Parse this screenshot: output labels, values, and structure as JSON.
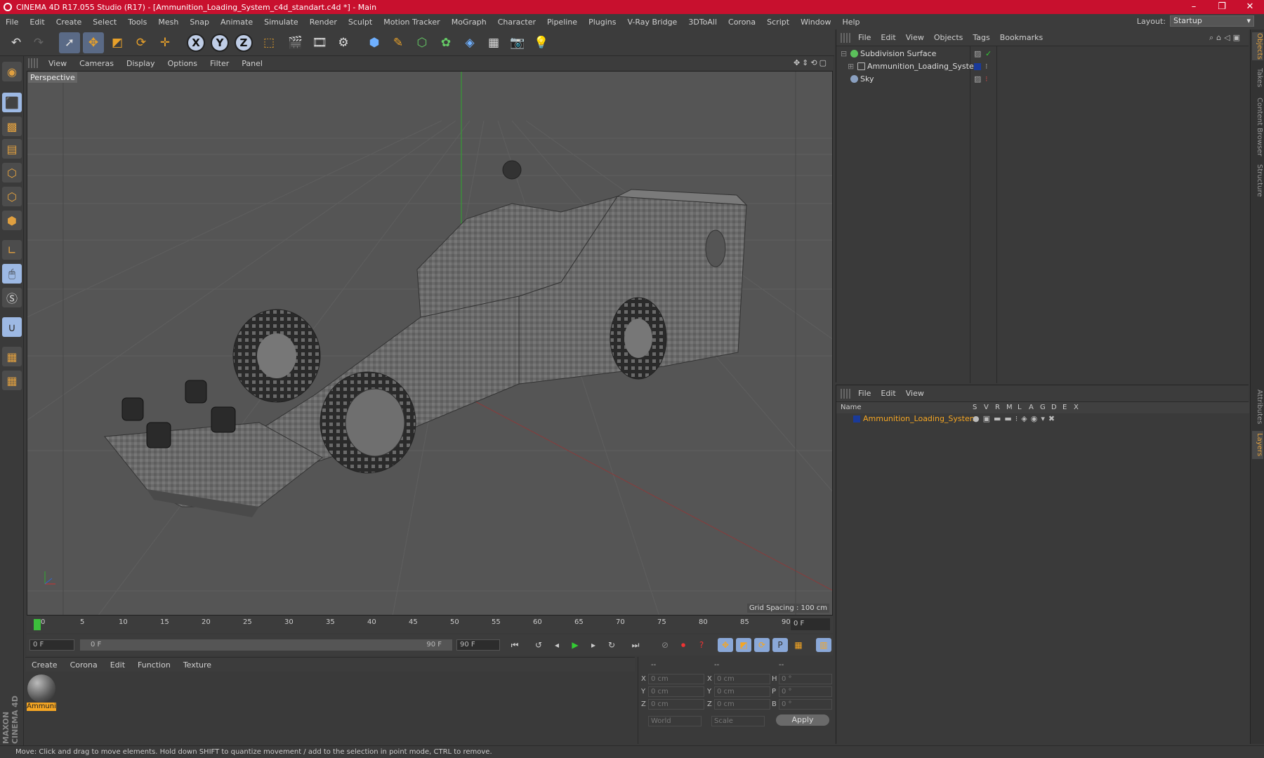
{
  "window": {
    "title": "CINEMA 4D R17.055 Studio (R17) - [Ammunition_Loading_System_c4d_standart.c4d *] - Main",
    "controls": [
      "–",
      "❐",
      "✕"
    ]
  },
  "menubar": {
    "items": [
      "File",
      "Edit",
      "Create",
      "Select",
      "Tools",
      "Mesh",
      "Snap",
      "Animate",
      "Simulate",
      "Render",
      "Sculpt",
      "Motion Tracker",
      "MoGraph",
      "Character",
      "Pipeline",
      "Plugins",
      "V-Ray Bridge",
      "3DToAll",
      "Corona",
      "Script",
      "Window",
      "Help"
    ],
    "layout_label": "Layout:",
    "layout_value": "Startup"
  },
  "viewport": {
    "menu": [
      "View",
      "Cameras",
      "Display",
      "Options",
      "Filter",
      "Panel"
    ],
    "label": "Perspective",
    "grid_spacing": "Grid Spacing : 100 cm"
  },
  "timeline": {
    "ticks": [
      "0",
      "5",
      "10",
      "15",
      "20",
      "25",
      "30",
      "35",
      "40",
      "45",
      "50",
      "55",
      "60",
      "65",
      "70",
      "75",
      "80",
      "85",
      "90"
    ],
    "current_frame": "0 F",
    "start_field": "0 F",
    "range_start": "0 F",
    "range_end": "90 F",
    "end_field": "90 F"
  },
  "material_panel": {
    "menu": [
      "Create",
      "Corona",
      "Edit",
      "Function",
      "Texture"
    ],
    "material_name": "Ammuni"
  },
  "coordinates": {
    "headers": [
      "--",
      "--",
      "--"
    ],
    "rows": [
      {
        "a": "X",
        "av": "0 cm",
        "b": "X",
        "bv": "0 cm",
        "c": "H",
        "cv": "0 °"
      },
      {
        "a": "Y",
        "av": "0 cm",
        "b": "Y",
        "bv": "0 cm",
        "c": "P",
        "cv": "0 °"
      },
      {
        "a": "Z",
        "av": "0 cm",
        "b": "Z",
        "bv": "0 cm",
        "c": "B",
        "cv": "0 °"
      }
    ],
    "mode": "World",
    "scale": "Scale",
    "apply": "Apply"
  },
  "object_manager": {
    "menu": [
      "File",
      "Edit",
      "View",
      "Objects",
      "Tags",
      "Bookmarks"
    ],
    "objects": [
      {
        "name": "Subdivision Surface",
        "color": "#5bc05b"
      },
      {
        "name": "Ammunition_Loading_System",
        "color": "#9ab"
      },
      {
        "name": "Sky",
        "color": "#8aa0c0"
      }
    ]
  },
  "layer_manager": {
    "menu": [
      "File",
      "Edit",
      "View"
    ],
    "columns": [
      "Name",
      "S",
      "V",
      "R",
      "M",
      "L",
      "A",
      "G",
      "D",
      "E",
      "X"
    ],
    "layer": "Ammunition_Loading_System",
    "layer_color": "#1a3a9a"
  },
  "right_tabs": [
    "Objects",
    "Takes",
    "Content Browser",
    "Structure",
    "Attributes",
    "Layers"
  ],
  "left_logo": "MAXON CINEMA 4D",
  "status": "Move: Click and drag to move elements. Hold down SHIFT to quantize movement / add to the selection in point mode, CTRL to remove.",
  "colors": {
    "accent": "#f5a623",
    "titlebar": "#c8102e"
  }
}
